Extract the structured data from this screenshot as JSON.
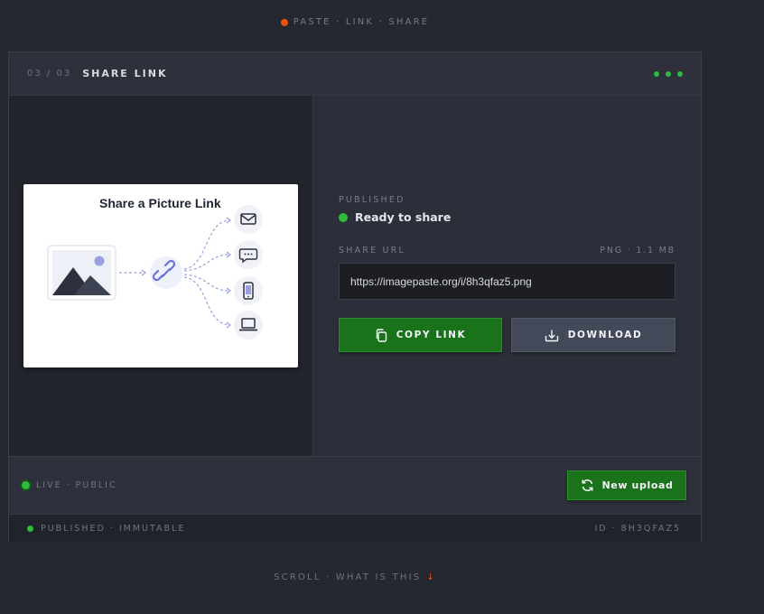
{
  "top_bar": {
    "label": "PASTE · LINK · SHARE"
  },
  "header": {
    "step": "03 / 03",
    "title": "SHARE LINK"
  },
  "preview": {
    "title": "Share a Picture Link"
  },
  "status": {
    "label": "PUBLISHED",
    "text": "Ready to share"
  },
  "share": {
    "label": "SHARE URL",
    "meta": "PNG · 1.1 MB",
    "url": "https://imagepaste.org/i/8h3qfaz5.png"
  },
  "buttons": {
    "copy": "COPY LINK",
    "download": "DOWNLOAD",
    "new_upload": "New upload"
  },
  "footer": {
    "status": "LIVE · PUBLIC"
  },
  "strip": {
    "left": "PUBLISHED · IMMUTABLE",
    "right": "ID · 8H3QFAZ5"
  },
  "bottom": {
    "label": "SCROLL · WHAT IS THIS",
    "arrow": "↓"
  },
  "colors": {
    "accent_green": "#1a731b",
    "status_green": "#2fbb3c",
    "orange": "#e8520e",
    "background": "#25282f"
  }
}
